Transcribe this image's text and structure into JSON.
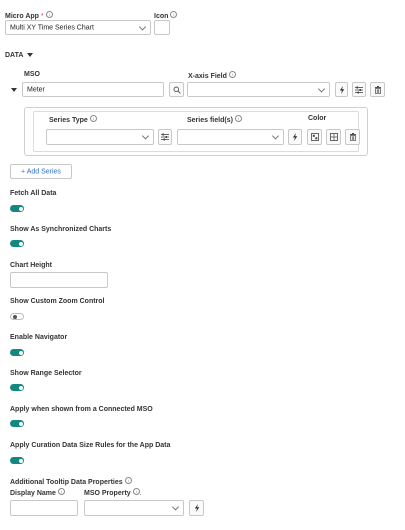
{
  "micro_app": {
    "label": "Micro App",
    "required_mark": "*",
    "value": "Multi XY Time Series Chart"
  },
  "icon": {
    "label": "Icon"
  },
  "data_section": {
    "label": "DATA"
  },
  "mso": {
    "label": "MSO",
    "value": "Meter"
  },
  "x_axis": {
    "label": "X-axis Field",
    "value": ""
  },
  "series": {
    "type_label": "Series Type",
    "fields_label": "Series field(s)",
    "color_label": "Color"
  },
  "add_series": {
    "label": "+ Add Series"
  },
  "settings": [
    {
      "label": "Fetch All Data",
      "on": true
    },
    {
      "label": "Show As Synchronized Charts",
      "on": true
    },
    {
      "label": "Chart Height",
      "input": true,
      "value": ""
    },
    {
      "label": "Show Custom Zoom Control",
      "on": false
    },
    {
      "label": "Enable Navigator",
      "on": true
    },
    {
      "label": "Show Range Selector",
      "on": true
    },
    {
      "label": "Apply when shown from a Connected MSO",
      "on": true
    },
    {
      "label": "Apply Curation Data Size Rules for the App Data",
      "on": true
    }
  ],
  "tooltip": {
    "label": "Additional Tooltip Data Properties",
    "display_name_label": "Display Name",
    "mso_property_label": "MSO Property"
  },
  "colors": {
    "accent": "#12887e",
    "link": "#2f6fc4",
    "required": "#e53935"
  }
}
